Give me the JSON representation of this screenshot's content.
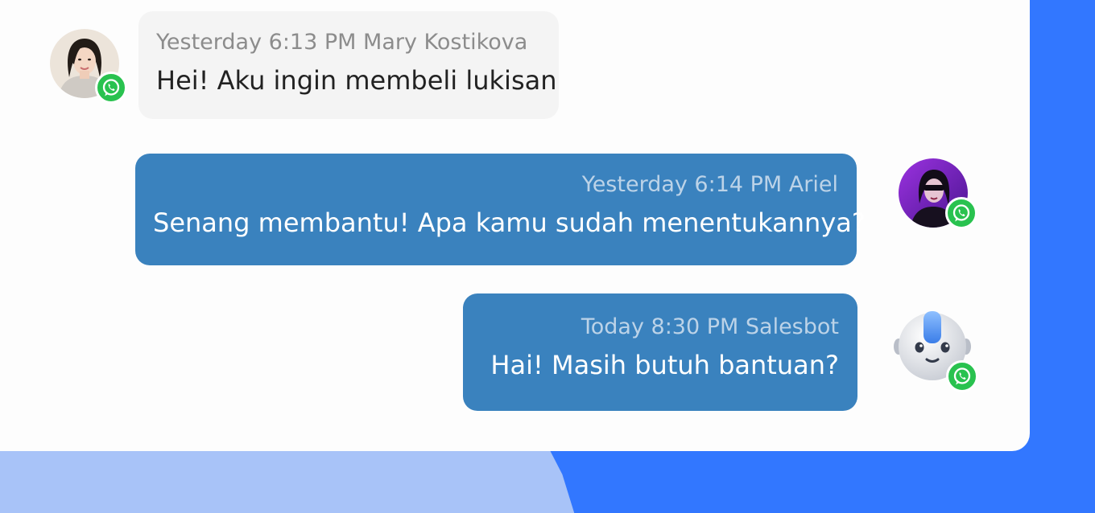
{
  "conversation": {
    "messages": [
      {
        "time": "Yesterday 6:13 PM",
        "sender": "Mary Kostikova",
        "meta": "Yesterday 6:13 PM Mary Kostikova",
        "text": "Hei! Aku ingin membeli lukisan",
        "direction": "incoming",
        "channel_icon": "whatsapp-icon"
      },
      {
        "time": "Yesterday 6:14 PM",
        "sender": "Ariel",
        "meta": "Yesterday 6:14 PM Ariel",
        "text": "Senang membantu! Apa kamu sudah menentukannya?",
        "direction": "outgoing",
        "channel_icon": "whatsapp-icon"
      },
      {
        "time": "Today 8:30 PM",
        "sender": "Salesbot",
        "meta": "Today 8:30 PM Salesbot",
        "text": "Hai! Masih butuh bantuan?",
        "direction": "outgoing",
        "channel_icon": "whatsapp-icon"
      }
    ]
  },
  "colors": {
    "page_background": "#3277ff",
    "page_background_light": "#a8c3f8",
    "card_background": "#fdfdfd",
    "incoming_bubble": "#f4f4f4",
    "outgoing_bubble": "#3a82be",
    "whatsapp_green": "#29c24f"
  }
}
